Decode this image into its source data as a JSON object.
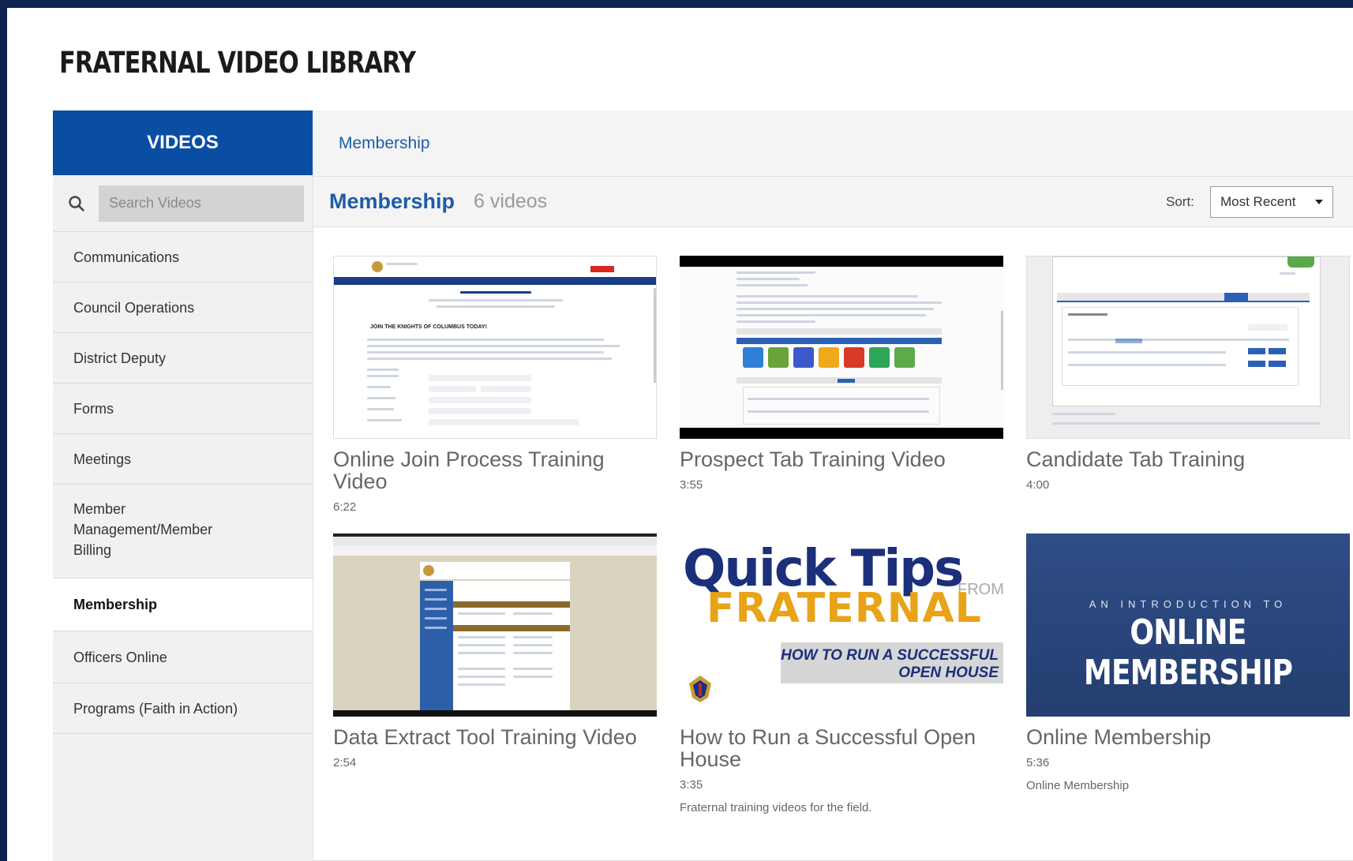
{
  "library_title": "FRATERNAL VIDEO LIBRARY",
  "sidebar": {
    "header": "VIDEOS",
    "search_placeholder": "Search Videos",
    "items": [
      {
        "label": "Communications"
      },
      {
        "label": "Council Operations"
      },
      {
        "label": "District Deputy"
      },
      {
        "label": "Forms"
      },
      {
        "label": "Meetings"
      },
      {
        "label": "Member Management/Member Billing"
      },
      {
        "label": "Membership",
        "active": true
      },
      {
        "label": "Officers Online"
      },
      {
        "label": "Programs (Faith in Action)"
      }
    ]
  },
  "breadcrumb": "Membership",
  "section": {
    "title": "Membership",
    "count": "6 videos"
  },
  "sort": {
    "label": "Sort:",
    "value": "Most Recent"
  },
  "videos": [
    {
      "title": "Online Join Process Training Video",
      "duration": "6:22",
      "description": ""
    },
    {
      "title": "Prospect Tab Training Video",
      "duration": "3:55",
      "description": ""
    },
    {
      "title": "Candidate Tab Training",
      "duration": "4:00",
      "description": ""
    },
    {
      "title": "Data Extract Tool Training Video",
      "duration": "2:54",
      "description": ""
    },
    {
      "title": "How to Run a Successful Open House",
      "duration": "3:35",
      "description": "Fraternal training videos for the field."
    },
    {
      "title": "Online Membership",
      "duration": "5:36",
      "description": "Online Membership"
    }
  ],
  "thumbnails": {
    "quick_tips": {
      "line1": "Quick Tips",
      "from": "FROM",
      "line2": "FRATERNAL",
      "banner1": "HOW TO RUN A SUCCESSFUL",
      "banner2": "OPEN HOUSE"
    },
    "online": {
      "intro": "AN INTRODUCTION TO",
      "title": "ONLINE MEMBERSHIP"
    },
    "web_heading": "JOIN THE KNIGHTS OF COLUMBUS TODAY!"
  },
  "colors": {
    "brand_blue": "#0a4ea3",
    "link_blue": "#1d5da8",
    "frame_navy": "#0d2350"
  }
}
